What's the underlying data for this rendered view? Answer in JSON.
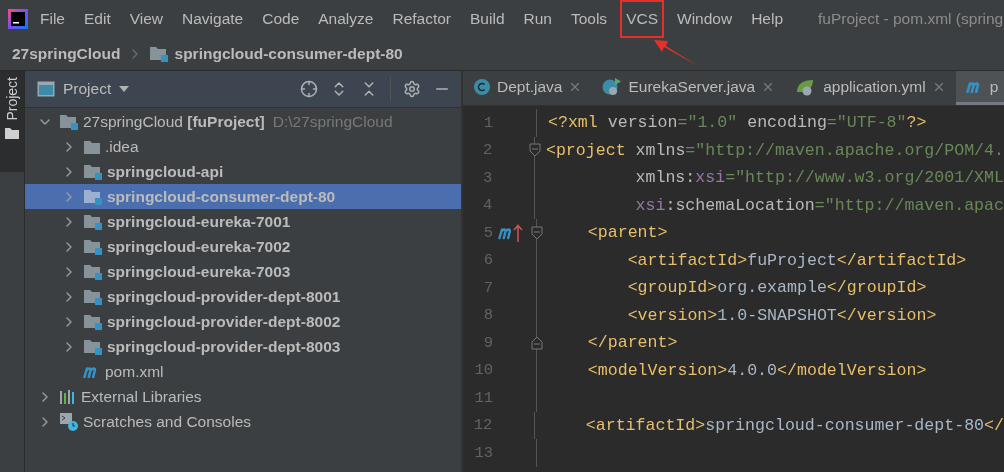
{
  "menu": [
    {
      "label": "File",
      "highlighted": false
    },
    {
      "label": "Edit",
      "highlighted": false
    },
    {
      "label": "View",
      "highlighted": false
    },
    {
      "label": "Navigate",
      "highlighted": false
    },
    {
      "label": "Code",
      "highlighted": false
    },
    {
      "label": "Analyze",
      "highlighted": false
    },
    {
      "label": "Refactor",
      "highlighted": false
    },
    {
      "label": "Build",
      "highlighted": false
    },
    {
      "label": "Run",
      "highlighted": false
    },
    {
      "label": "Tools",
      "highlighted": false
    },
    {
      "label": "VCS",
      "highlighted": true
    },
    {
      "label": "Window",
      "highlighted": false
    },
    {
      "label": "Help",
      "highlighted": false
    }
  ],
  "window": {
    "title": "fuProject - pom.xml (spring"
  },
  "breadcrumb": [
    "27springCloud",
    "springcloud-consumer-dept-80"
  ],
  "side_strip": {
    "tab": "Project",
    "selected": true
  },
  "project_panel": {
    "title": "Project",
    "tree": [
      {
        "label": "27springCloud **[fuProject]**",
        "path": "D:\\27springCloud",
        "kind": "module",
        "bold": false,
        "selected": false,
        "expanded": true,
        "children": [
          {
            "label": ".idea",
            "kind": "folder",
            "bold": false,
            "selected": false,
            "expanded": false
          },
          {
            "label": "springcloud-api",
            "kind": "module",
            "bold": true,
            "selected": false,
            "expanded": false
          },
          {
            "label": "springcloud-consumer-dept-80",
            "kind": "module",
            "bold": true,
            "selected": true,
            "expanded": false
          },
          {
            "label": "springcloud-eureka-7001",
            "kind": "module",
            "bold": true,
            "selected": false,
            "expanded": false
          },
          {
            "label": "springcloud-eureka-7002",
            "kind": "module",
            "bold": true,
            "selected": false,
            "expanded": false
          },
          {
            "label": "springcloud-eureka-7003",
            "kind": "module",
            "bold": true,
            "selected": false,
            "expanded": false
          },
          {
            "label": "springcloud-provider-dept-8001",
            "kind": "module",
            "bold": true,
            "selected": false,
            "expanded": false
          },
          {
            "label": "springcloud-provider-dept-8002",
            "kind": "module",
            "bold": true,
            "selected": false,
            "expanded": false
          },
          {
            "label": "springcloud-provider-dept-8003",
            "kind": "module",
            "bold": true,
            "selected": false,
            "expanded": false
          },
          {
            "label": "pom.xml",
            "kind": "maven",
            "bold": false,
            "selected": false
          }
        ]
      },
      {
        "label": "External Libraries",
        "kind": "libraries",
        "bold": false,
        "selected": false,
        "expanded": false
      },
      {
        "label": "Scratches and Consoles",
        "kind": "scratches",
        "bold": false,
        "selected": false,
        "expanded": false
      }
    ]
  },
  "editor": {
    "tabs": [
      {
        "label": "Dept.java",
        "kind": "class",
        "selected": false
      },
      {
        "label": "EurekaServer.java",
        "kind": "runnable",
        "selected": false
      },
      {
        "label": "application.yml",
        "kind": "spring",
        "selected": false
      },
      {
        "label": "p",
        "kind": "maven",
        "selected": true
      }
    ],
    "lines": [
      {
        "number": "1",
        "tokens": [
          {
            "kind": "tag",
            "text": "<?xml "
          },
          {
            "kind": "attr",
            "text": "version"
          },
          {
            "kind": "str",
            "text": "=\"1.0\" "
          },
          {
            "kind": "attr",
            "text": "encoding"
          },
          {
            "kind": "str",
            "text": "=\"UTF-8\""
          },
          {
            "kind": "tag",
            "text": "?>"
          }
        ]
      },
      {
        "number": "2",
        "fold_start": true,
        "tokens": [
          {
            "kind": "tag",
            "text": "<project "
          },
          {
            "kind": "attr",
            "text": "xmlns"
          },
          {
            "kind": "str",
            "text": "=\"http://maven.apache.org/POM/4."
          }
        ]
      },
      {
        "number": "3",
        "tokens": [
          {
            "kind": "attr",
            "text": "         xmlns:"
          },
          {
            "kind": "ns",
            "text": "xsi"
          },
          {
            "kind": "str",
            "text": "=\"http://www.w3.org/2001/XML"
          }
        ]
      },
      {
        "number": "4",
        "tokens": [
          {
            "kind": "ns",
            "text": "         xsi"
          },
          {
            "kind": "attr",
            "text": ":schemaLocation"
          },
          {
            "kind": "str",
            "text": "=\"http://maven.apac"
          }
        ]
      },
      {
        "number": "5",
        "fold_start": true,
        "override": true,
        "tokens": [
          {
            "kind": "tag",
            "text": "    <parent>"
          }
        ]
      },
      {
        "number": "6",
        "tokens": [
          {
            "kind": "tag",
            "text": "        <artifactId>"
          },
          {
            "kind": "text",
            "text": "fuProject"
          },
          {
            "kind": "tag",
            "text": "</artifactId>"
          }
        ]
      },
      {
        "number": "7",
        "tokens": [
          {
            "kind": "tag",
            "text": "        <groupId>"
          },
          {
            "kind": "text",
            "text": "org.example"
          },
          {
            "kind": "tag",
            "text": "</groupId>"
          }
        ]
      },
      {
        "number": "8",
        "tokens": [
          {
            "kind": "tag",
            "text": "        <version>"
          },
          {
            "kind": "text",
            "text": "1.0-SNAPSHOT"
          },
          {
            "kind": "tag",
            "text": "</version>"
          }
        ]
      },
      {
        "number": "9",
        "fold_end": true,
        "tokens": [
          {
            "kind": "tag",
            "text": "    </parent>"
          }
        ]
      },
      {
        "number": "10",
        "tokens": [
          {
            "kind": "tag",
            "text": "    <modelVersion>"
          },
          {
            "kind": "text",
            "text": "4.0.0"
          },
          {
            "kind": "tag",
            "text": "</modelVersion>"
          }
        ]
      },
      {
        "number": "11"
      },
      {
        "number": "12",
        "tokens": [
          {
            "kind": "tag",
            "text": "    <artifactId>"
          },
          {
            "kind": "text",
            "text": "springcloud-consumer-dept-80"
          },
          {
            "kind": "tag",
            "text": "</"
          }
        ]
      },
      {
        "number": "13"
      }
    ]
  }
}
